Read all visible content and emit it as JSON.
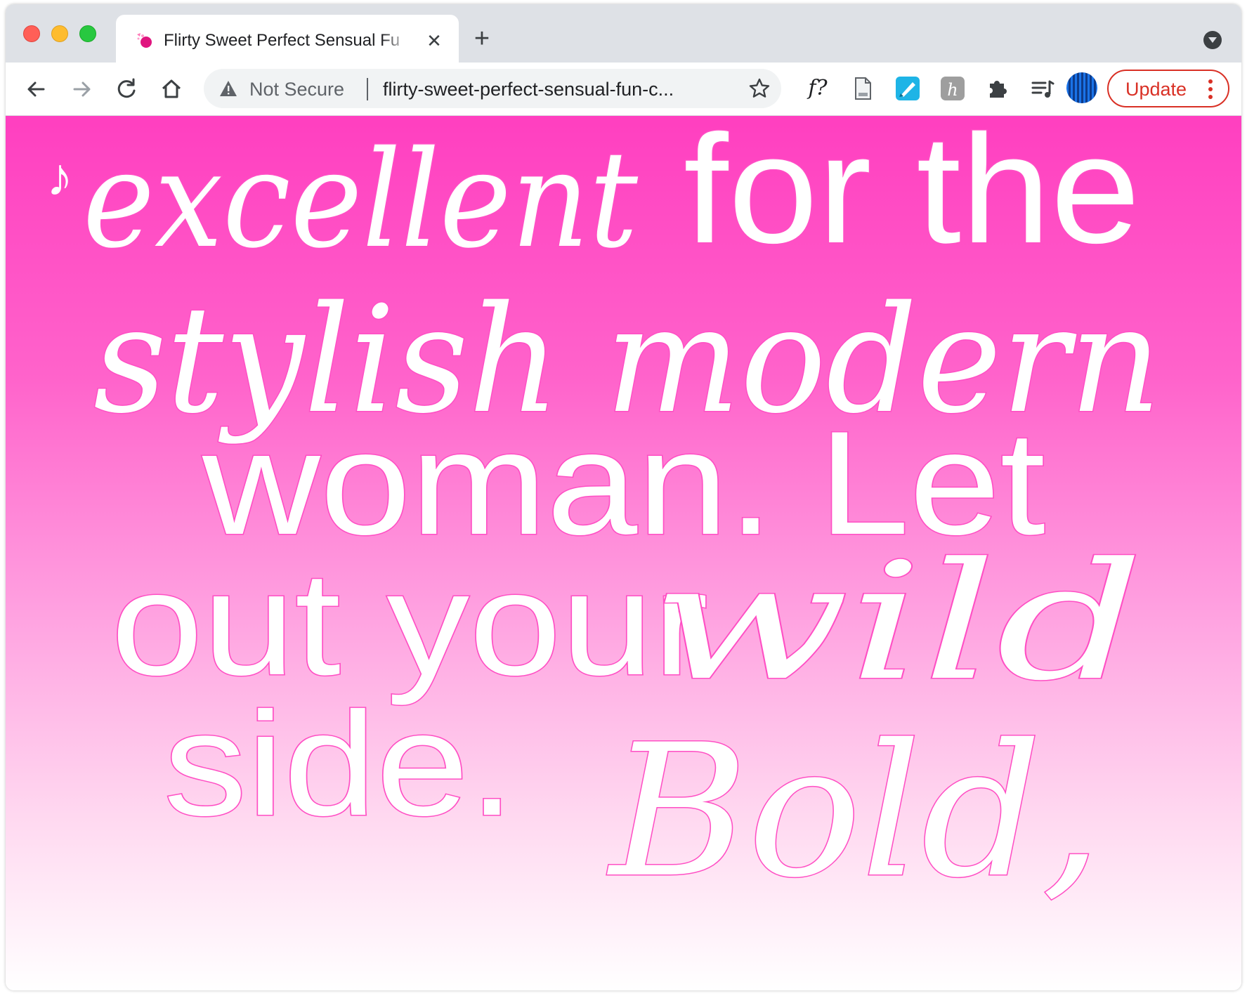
{
  "browser": {
    "tab": {
      "title": "Flirty Sweet Perfect Sensual Fu",
      "close_glyph": "✕",
      "favicon": "pink-heart-favicon"
    },
    "new_tab_glyph": "+",
    "toolbar": {
      "back_icon": "arrow-left-icon",
      "forward_icon": "arrow-right-icon",
      "reload_icon": "reload-icon",
      "home_icon": "home-icon",
      "security_label": "Not Secure",
      "url": "flirty-sweet-perfect-sensual-fun-c...",
      "bookmark_icon": "star-icon",
      "extensions": [
        "font-question-icon",
        "document-icon",
        "pen-extension-icon",
        "h-extension-icon",
        "puzzle-icon",
        "reading-list-icon"
      ],
      "extension_fq_label": "f?",
      "update_label": "Update"
    },
    "colors": {
      "tabstrip": "#dee1e6",
      "update_red": "#d93025",
      "page_pink": "#ff3fc0"
    }
  },
  "page": {
    "music_note": "♪",
    "poster_lines": {
      "line1_script": "excellent",
      "line1_sans": "for the",
      "line2_script": "stylish modern",
      "line3_sans": "woman. Let",
      "line4_sans": "out your",
      "line4_script": "wild",
      "line5_sans": "side.",
      "line5_script": "Bold,"
    }
  }
}
